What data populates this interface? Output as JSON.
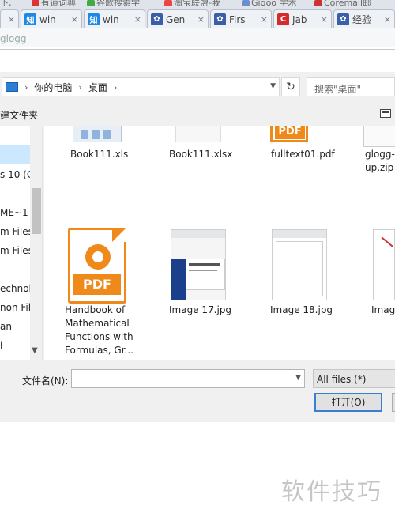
{
  "browser": {
    "top_fragments": [
      "下,",
      "有道词典",
      "谷歌搜索学",
      "淘宝联盟-我",
      "Gigoo 学术",
      "Coremail邮"
    ],
    "tabs": [
      {
        "icon": "zhihu-icon",
        "color": "#1e88e5",
        "glyph": "知",
        "title": "win"
      },
      {
        "icon": "zhihu-icon",
        "color": "#1e88e5",
        "glyph": "知",
        "title": "win"
      },
      {
        "icon": "paw-icon",
        "color": "#3a5fa8",
        "glyph": "🐾",
        "title": "Gen"
      },
      {
        "icon": "paw-icon",
        "color": "#3a5fa8",
        "glyph": "🐾",
        "title": "Firs"
      },
      {
        "icon": "c-logo-icon",
        "color": "#d62b2b",
        "glyph": "C",
        "title": "Jab"
      },
      {
        "icon": "paw-icon",
        "color": "#3a5fa8",
        "glyph": "🐾",
        "title": "经验"
      }
    ],
    "url_fragment": "glogg"
  },
  "dialog": {
    "address": {
      "crumbs": [
        "你的电脑",
        "桌面"
      ]
    },
    "search_placeholder": "搜索\"桌面\"",
    "new_folder_label": "建文件夹",
    "sidebar": [
      "s 10 (C",
      "ME~1",
      "m Files",
      "m Files",
      "echnolo",
      "non Fil",
      "an",
      "l"
    ],
    "files": [
      {
        "name": "Book111.xls",
        "kind": "excel"
      },
      {
        "name": "Book111.xlsx",
        "kind": "excel"
      },
      {
        "name": "fulltext01.pdf",
        "kind": "pdf"
      },
      {
        "name": "glogg-\nup.zip",
        "kind": "zip"
      },
      {
        "name": "Handbook of Mathematical Functions with Formulas, Gr...",
        "kind": "pdf"
      },
      {
        "name": "Image 17.jpg",
        "kind": "image"
      },
      {
        "name": "Image 18.jpg",
        "kind": "image"
      },
      {
        "name": "Imag",
        "kind": "image"
      }
    ],
    "pdf_badge": "PDF",
    "filename_label": "文件名(N):",
    "filename_value": "",
    "filter_value": "All files (*)",
    "open_label": "打开(O)"
  },
  "watermark": "软件技巧"
}
